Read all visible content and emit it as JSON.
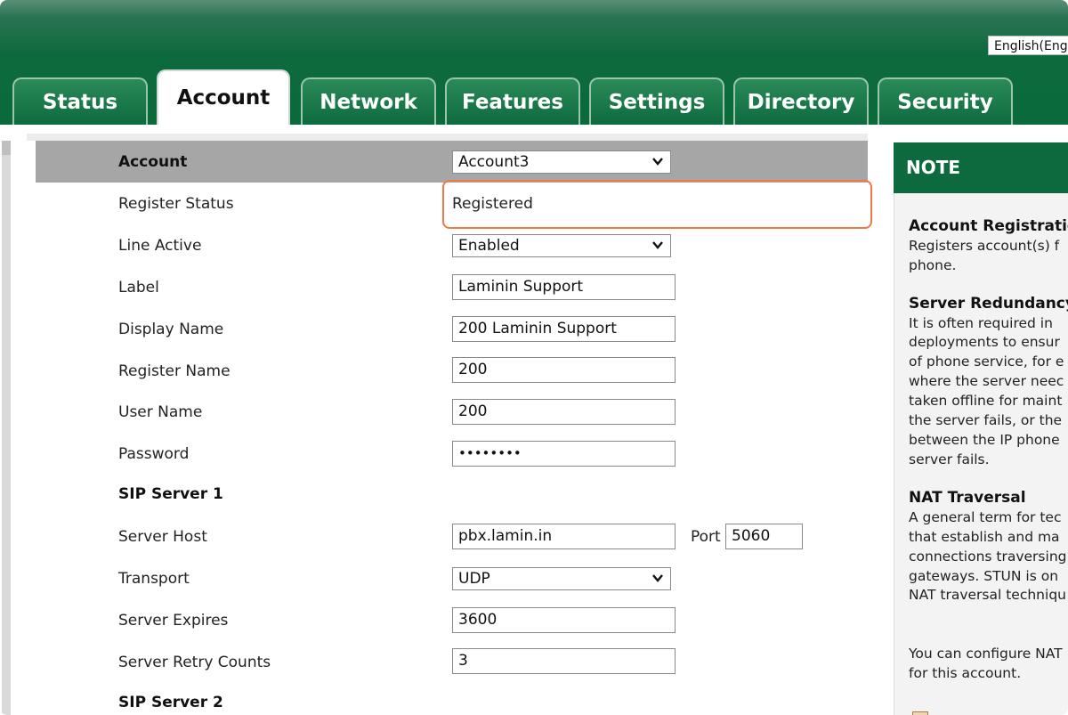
{
  "language": "English(Eng",
  "tabs": [
    {
      "label": "Status"
    },
    {
      "label": "Account"
    },
    {
      "label": "Network"
    },
    {
      "label": "Features"
    },
    {
      "label": "Settings"
    },
    {
      "label": "Directory"
    },
    {
      "label": "Security"
    }
  ],
  "form": {
    "account_label": "Account",
    "account_value": "Account3",
    "register_status_label": "Register Status",
    "register_status_value": "Registered",
    "line_active_label": "Line Active",
    "line_active_value": "Enabled",
    "label_label": "Label",
    "label_value": "Laminin Support",
    "display_name_label": "Display Name",
    "display_name_value": "200 Laminin Support",
    "register_name_label": "Register Name",
    "register_name_value": "200",
    "user_name_label": "User Name",
    "user_name_value": "200",
    "password_label": "Password",
    "password_value": "••••••••",
    "sip_server1_label": "SIP Server 1",
    "server_host_label": "Server Host",
    "server_host_value": "pbx.lamin.in",
    "port_label": "Port",
    "port_value": "5060",
    "transport_label": "Transport",
    "transport_value": "UDP",
    "server_expires_label": "Server Expires",
    "server_expires_value": "3600",
    "server_retry_label": "Server Retry Counts",
    "server_retry_value": "3",
    "sip_server2_label": "SIP Server 2"
  },
  "note": {
    "title": "NOTE",
    "account_registration_title": "Account Registratic",
    "account_registration_lines": [
      "Registers account(s) f",
      "phone."
    ],
    "server_redundancy_title": "Server Redundancy",
    "server_redundancy_lines": [
      "It is often required in",
      "deployments to ensur",
      "of phone service, for e",
      "where the server neec",
      "taken offline for maint",
      "the server fails, or the",
      "between the IP phone",
      "server fails."
    ],
    "nat_title": "NAT Traversal",
    "nat_lines": [
      "A general term for tec",
      "that establish and ma",
      "connections traversing",
      "gateways. STUN is on",
      "NAT traversal techniqu"
    ],
    "configure_lines": [
      "You can configure NAT",
      "for this account."
    ]
  },
  "colors": {
    "brand_green": "#0d6a3e",
    "highlight": "#f07a45"
  }
}
